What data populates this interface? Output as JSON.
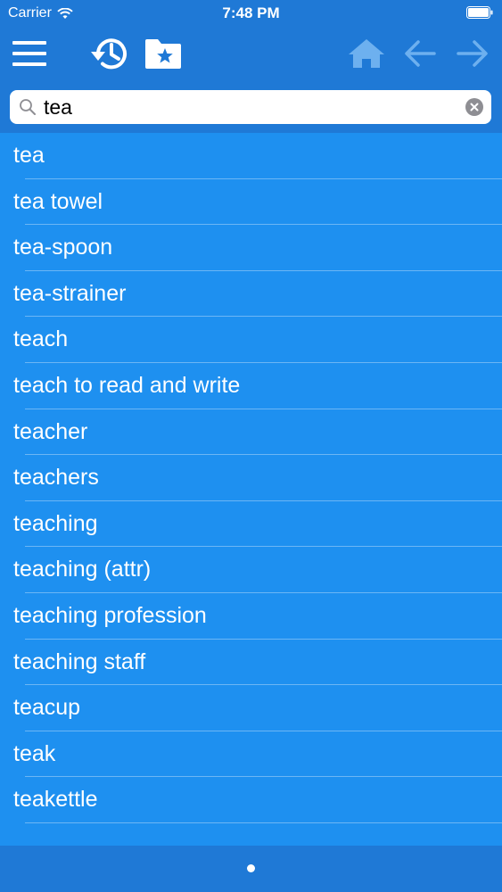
{
  "status_bar": {
    "carrier": "Carrier",
    "time": "7:48 PM"
  },
  "toolbar": {
    "icons": [
      "menu-icon",
      "history-icon",
      "favorites-folder-icon",
      "home-icon",
      "back-arrow-icon",
      "forward-arrow-icon"
    ]
  },
  "search": {
    "value": "tea",
    "placeholder": ""
  },
  "results": [
    "tea",
    "tea towel",
    "tea-spoon",
    "tea-strainer",
    "teach",
    "teach to read and write",
    "teacher",
    "teachers",
    "teaching",
    "teaching (attr)",
    "teaching profession",
    "teaching staff",
    "teacup",
    "teak",
    "teakettle"
  ],
  "colors": {
    "toolbar_bg": "#1f79d6",
    "list_bg": "#1e90f0",
    "disabled_icon": "#6db0ef"
  }
}
